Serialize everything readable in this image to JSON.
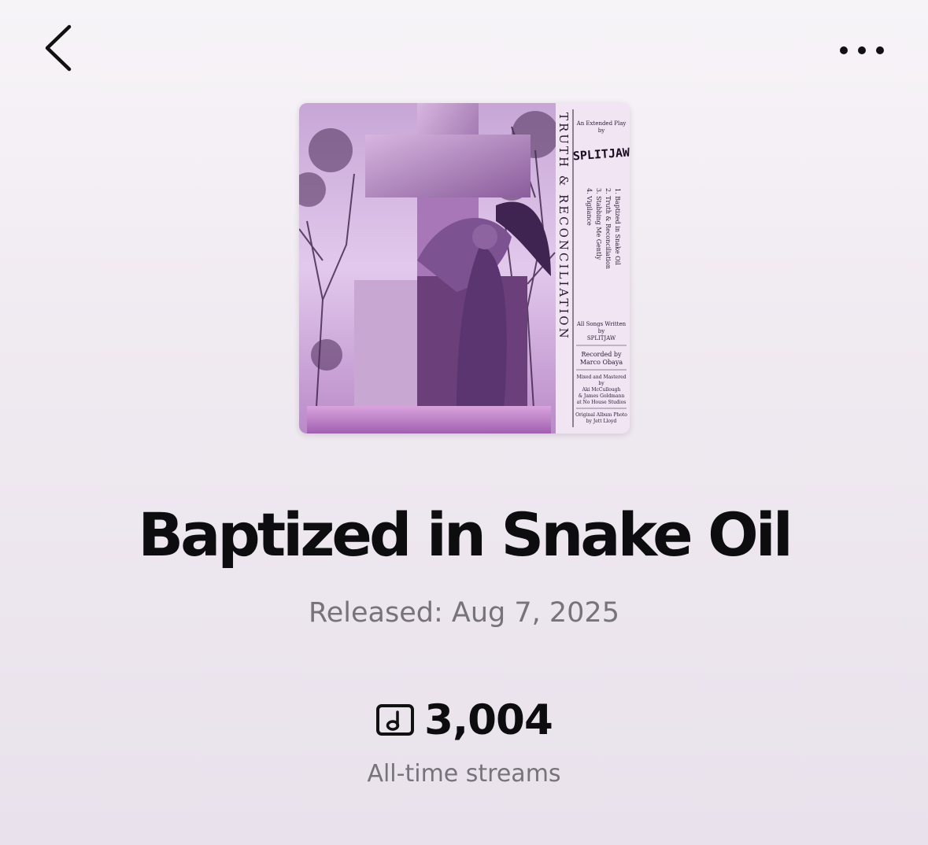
{
  "header": {
    "back_icon": "chevron-left-icon",
    "more_icon": "more-horizontal-icon"
  },
  "album": {
    "title": "Baptized in Snake Oil",
    "released": "Released: Aug 7, 2025",
    "streams_icon": "music-note-square-icon",
    "streams_count": "3,004",
    "streams_label": "All-time streams"
  },
  "cover_art": {
    "spine_title": "TRUTH & RECONCILIATION",
    "ep_line_1": "An Extended Play",
    "ep_line_2": "by",
    "artist_logo": "SPLITJAW",
    "tracks": [
      "1. Baptized in Snake Oil",
      "2. Truth & Reconciliation",
      "3. Stabbing Me Gently",
      "4. Vigilance"
    ],
    "credits_written": [
      "All Songs Written",
      "by",
      "SPLITJAW"
    ],
    "credits_recorded": [
      "Recorded by",
      "Marco Obaya"
    ],
    "credits_mixed": [
      "Mixed and Mastered",
      "by",
      "Aki McCullough",
      "& James Goldmann",
      "at No House Studios"
    ],
    "credits_photo": [
      "Original Album Photo",
      "by Jett Lloyd"
    ]
  }
}
